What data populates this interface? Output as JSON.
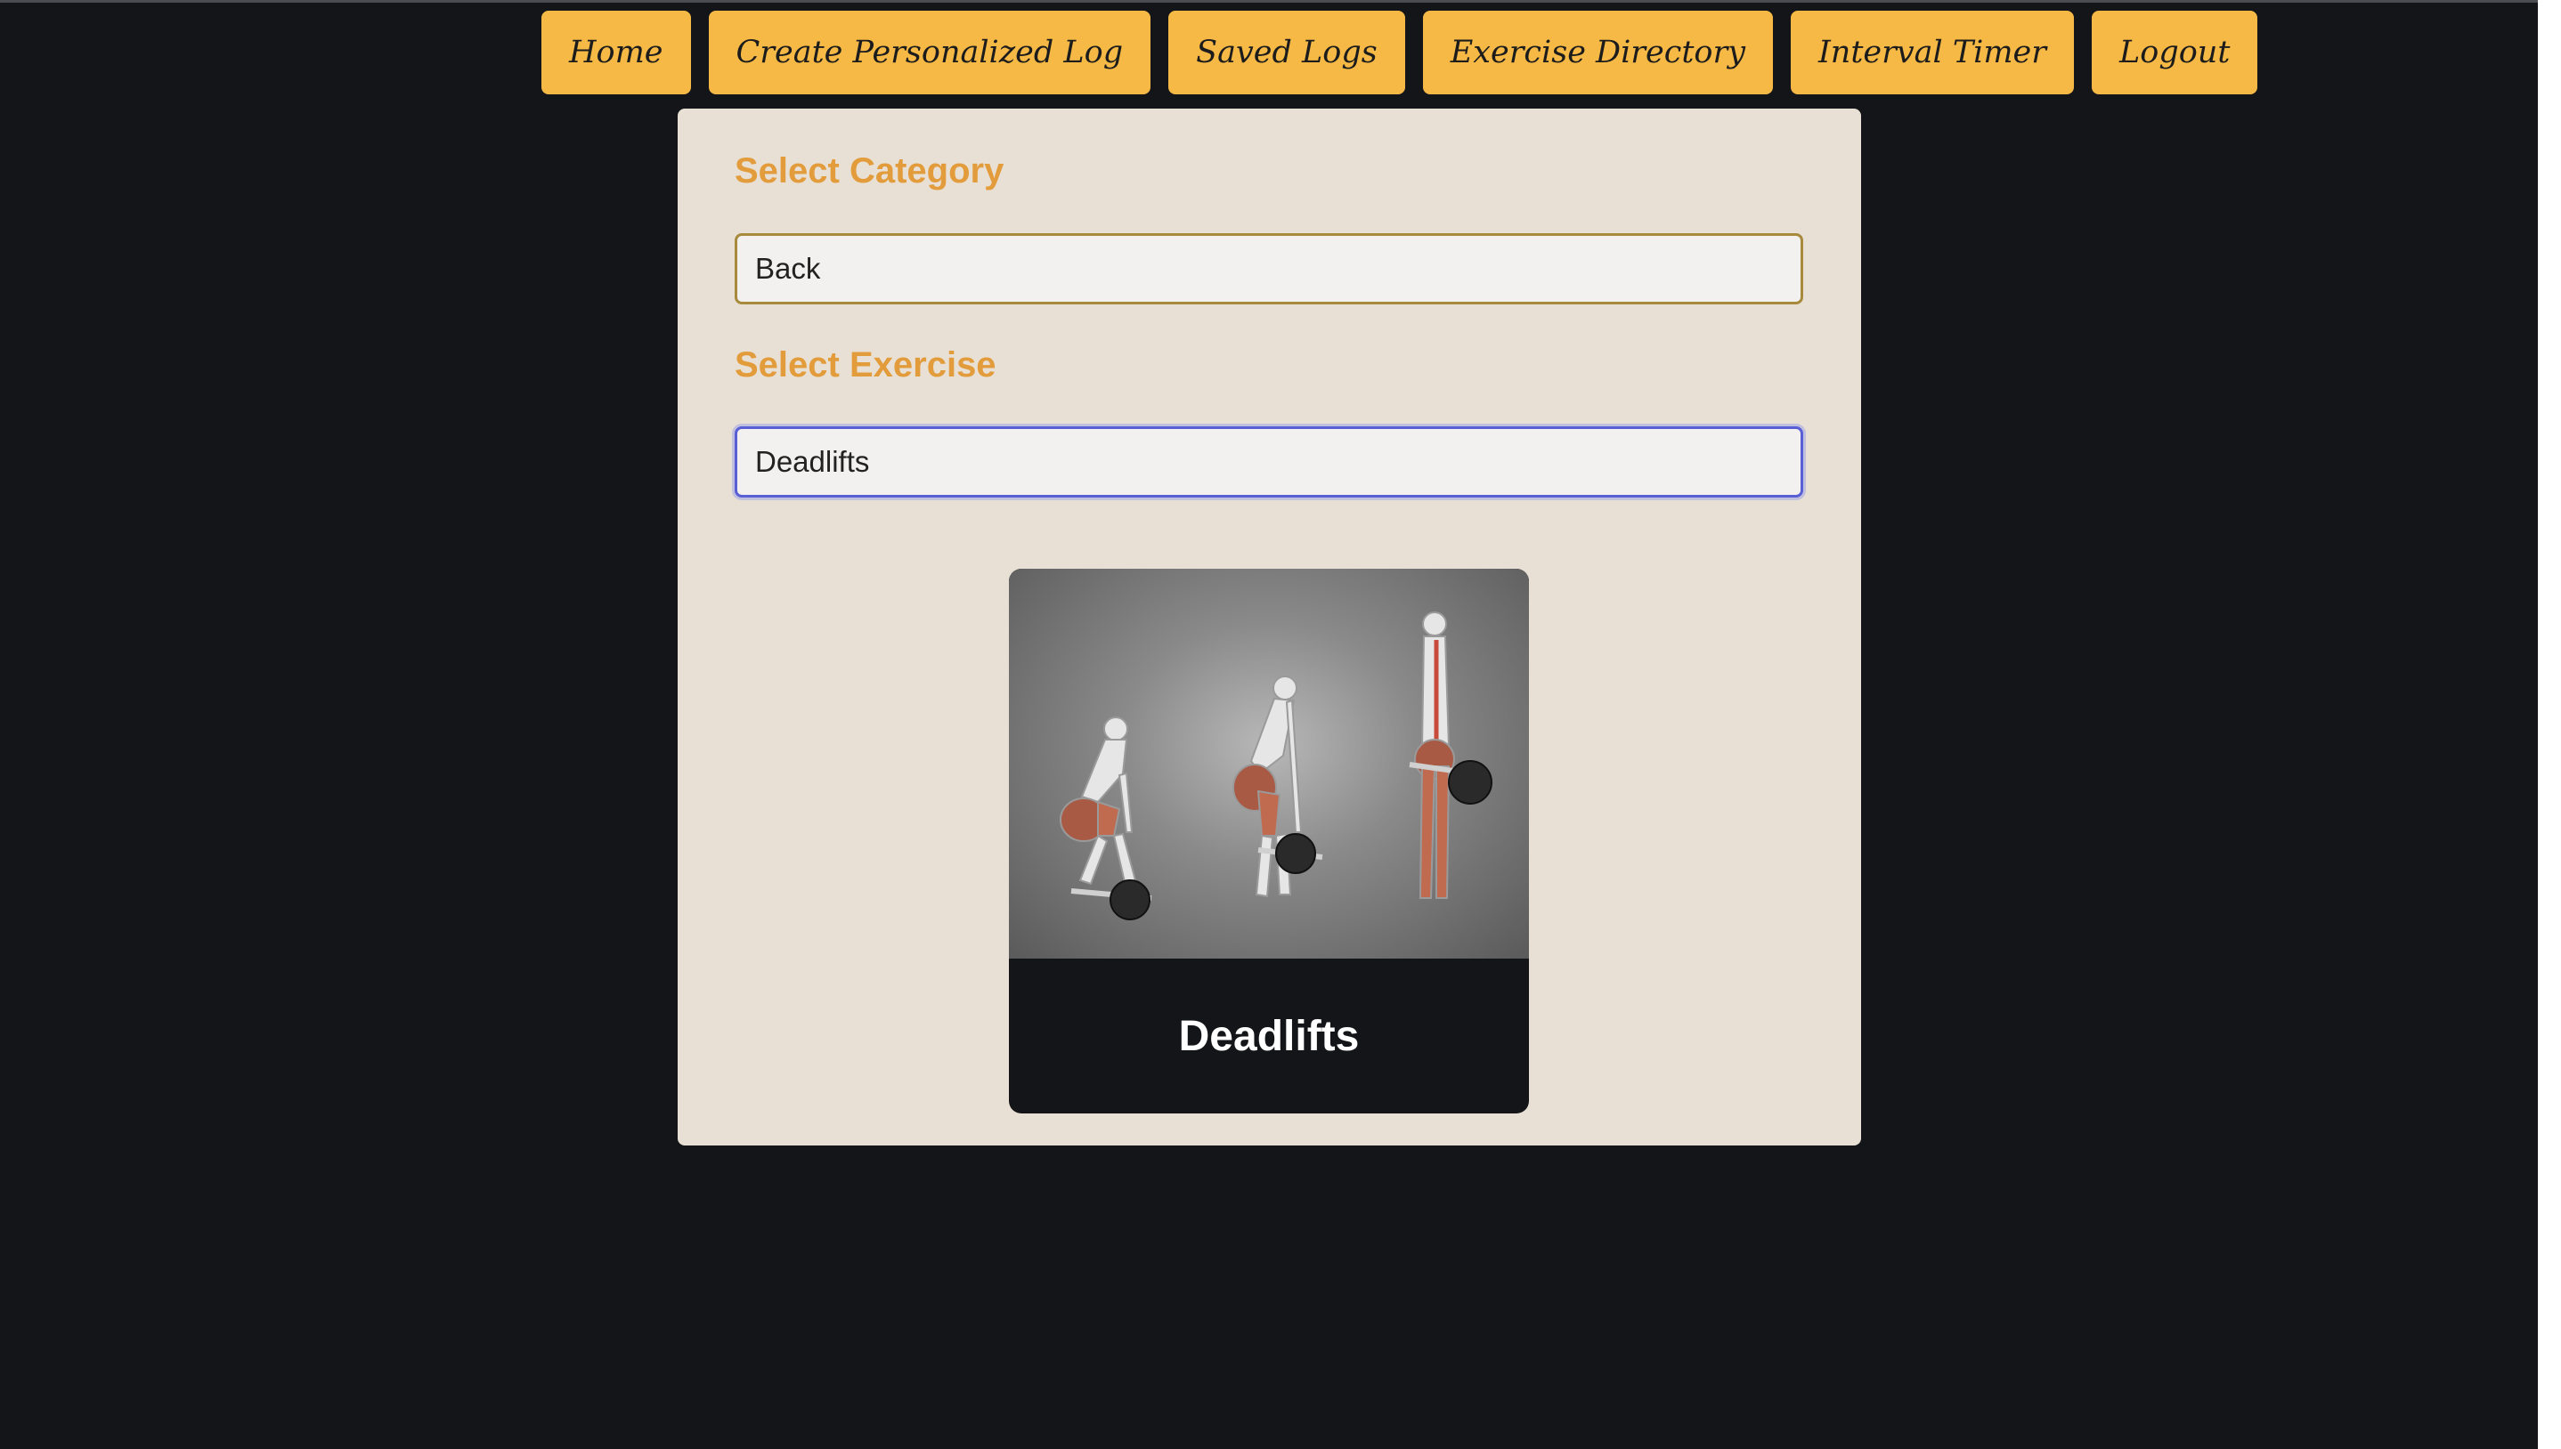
{
  "nav": {
    "items": [
      {
        "label": "Home"
      },
      {
        "label": "Create Personalized Log"
      },
      {
        "label": "Saved Logs"
      },
      {
        "label": "Exercise Directory"
      },
      {
        "label": "Interval Timer"
      },
      {
        "label": "Logout"
      }
    ]
  },
  "form": {
    "category_label": "Select Category",
    "category_value": "Back",
    "exercise_label": "Select Exercise",
    "exercise_value": "Deadlifts"
  },
  "card": {
    "title": "Deadlifts",
    "image_icon": "deadlift-illustration-icon"
  },
  "colors": {
    "background": "#141519",
    "nav_button": "#f6b945",
    "panel": "#e8e0d4",
    "label_accent": "#e39c3c",
    "focus_border": "#5a5fd6"
  }
}
